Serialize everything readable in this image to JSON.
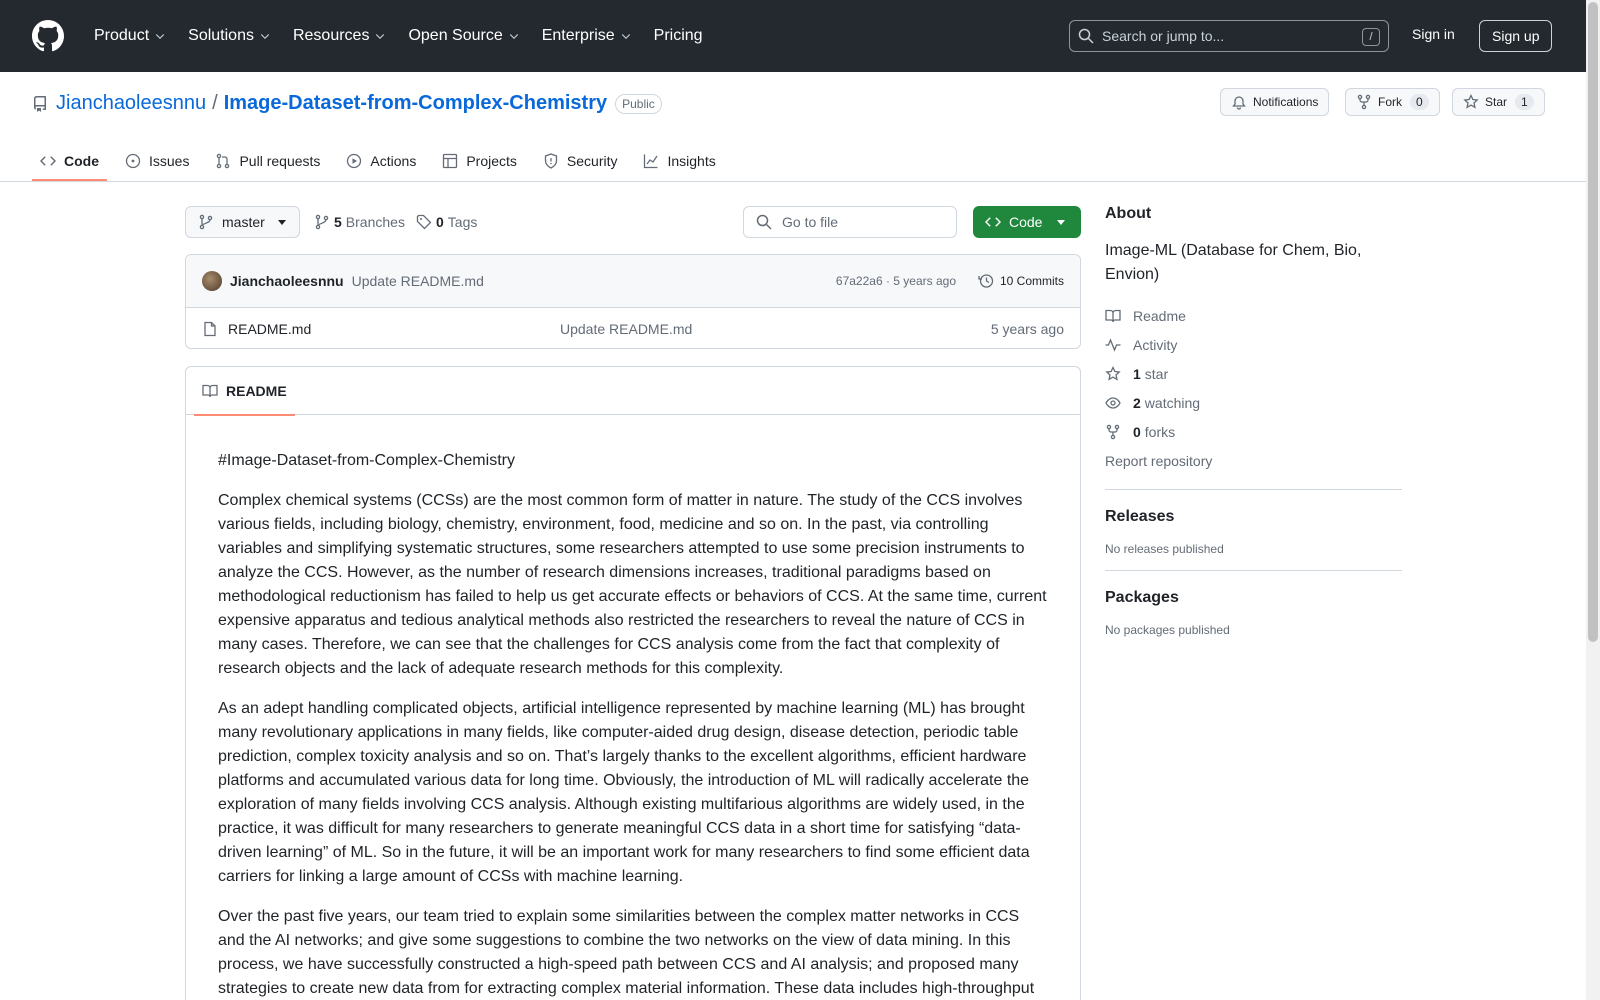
{
  "header": {
    "nav": [
      "Product",
      "Solutions",
      "Resources",
      "Open Source",
      "Enterprise",
      "Pricing"
    ],
    "search_placeholder": "Search or jump to...",
    "search_shortcut": "/",
    "signin": "Sign in",
    "signup": "Sign up"
  },
  "repo": {
    "owner": "Jianchaoleesnnu",
    "separator": "/",
    "name": "Image-Dataset-from-Complex-Chemistry",
    "visibility": "Public",
    "notifications_label": "Notifications",
    "fork_label": "Fork",
    "fork_count": "0",
    "star_label": "Star",
    "star_count": "1"
  },
  "tabs": [
    {
      "label": "Code",
      "icon": "code-icon",
      "active": true
    },
    {
      "label": "Issues",
      "icon": "issue-icon"
    },
    {
      "label": "Pull requests",
      "icon": "pull-request-icon"
    },
    {
      "label": "Actions",
      "icon": "play-icon"
    },
    {
      "label": "Projects",
      "icon": "table-icon"
    },
    {
      "label": "Security",
      "icon": "shield-icon"
    },
    {
      "label": "Insights",
      "icon": "graph-icon"
    }
  ],
  "toolbar": {
    "branch": "master",
    "branches_count": "5",
    "branches_label": "Branches",
    "tags_count": "0",
    "tags_label": "Tags",
    "goto_placeholder": "Go to file",
    "code_label": "Code"
  },
  "commit": {
    "author": "Jianchaoleesnnu",
    "message": "Update README.md",
    "hash_time": "67a22a6 · 5 years ago",
    "commits_label": "10 Commits"
  },
  "files": [
    {
      "name": "README.md",
      "message": "Update README.md",
      "time": "5 years ago"
    }
  ],
  "readme": {
    "tab_label": "README",
    "heading": "#Image-Dataset-from-Complex-Chemistry",
    "p1": "Complex chemical systems (CCSs) are the most common form of matter in nature. The study of the CCS involves various fields, including biology, chemistry, environment, food, medicine and so on. In the past, via controlling variables and simplifying systematic structures, some researchers attempted to use some precision instruments to analyze the CCS. However, as the number of research dimensions increases, traditional paradigms based on methodological reductionism has failed to help us get accurate effects or behaviors of CCS. At the same time, current expensive apparatus and tedious analytical methods also restricted the researchers to reveal the nature of CCS in many cases. Therefore, we can see that the challenges for CCS analysis come from the fact that complexity of research objects and the lack of adequate research methods for this complexity.",
    "p2": "As an adept handling complicated objects, artificial intelligence represented by machine learning (ML) has brought many revolutionary applications in many fields, like computer-aided drug design, disease detection, periodic table prediction, complex toxicity analysis and so on. That’s largely thanks to the excellent algorithms, efficient hardware platforms and accumulated various data for long time. Obviously, the introduction of ML will radically accelerate the exploration of many fields involving CCS analysis. Although existing multifarious algorithms are widely used, in the practice, it was difficult for many researchers to generate meaningful CCS data in a short time for satisfying “data-driven learning” of ML. So in the future, it will be an important work for many researchers to find some efficient data carriers for linking a large amount of CCSs with machine learning.",
    "p3": "Over the past five years, our team tried to explain some similarities between the complex matter networks in CCS and the AI networks; and give some suggestions to combine the two networks on the view of data mining. In this process, we have successfully constructed a high-speed path between CCS and AI analysis; and proposed many strategies to create new data from for extracting complex material information. These data includes high-throughput"
  },
  "sidebar": {
    "about_title": "About",
    "description": "Image-ML (Database for Chem, Bio, Envion)",
    "readme": "Readme",
    "activity": "Activity",
    "stars_count": "1",
    "stars_label": "star",
    "watching_count": "2",
    "watching_label": "watching",
    "forks_count": "0",
    "forks_label": "forks",
    "report": "Report repository",
    "releases_title": "Releases",
    "releases_none": "No releases published",
    "packages_title": "Packages",
    "packages_none": "No packages published"
  },
  "colors": {
    "header_bg": "#24292f",
    "link": "#0969da",
    "green": "#1f883d",
    "tab_underline": "#fd8c73"
  }
}
